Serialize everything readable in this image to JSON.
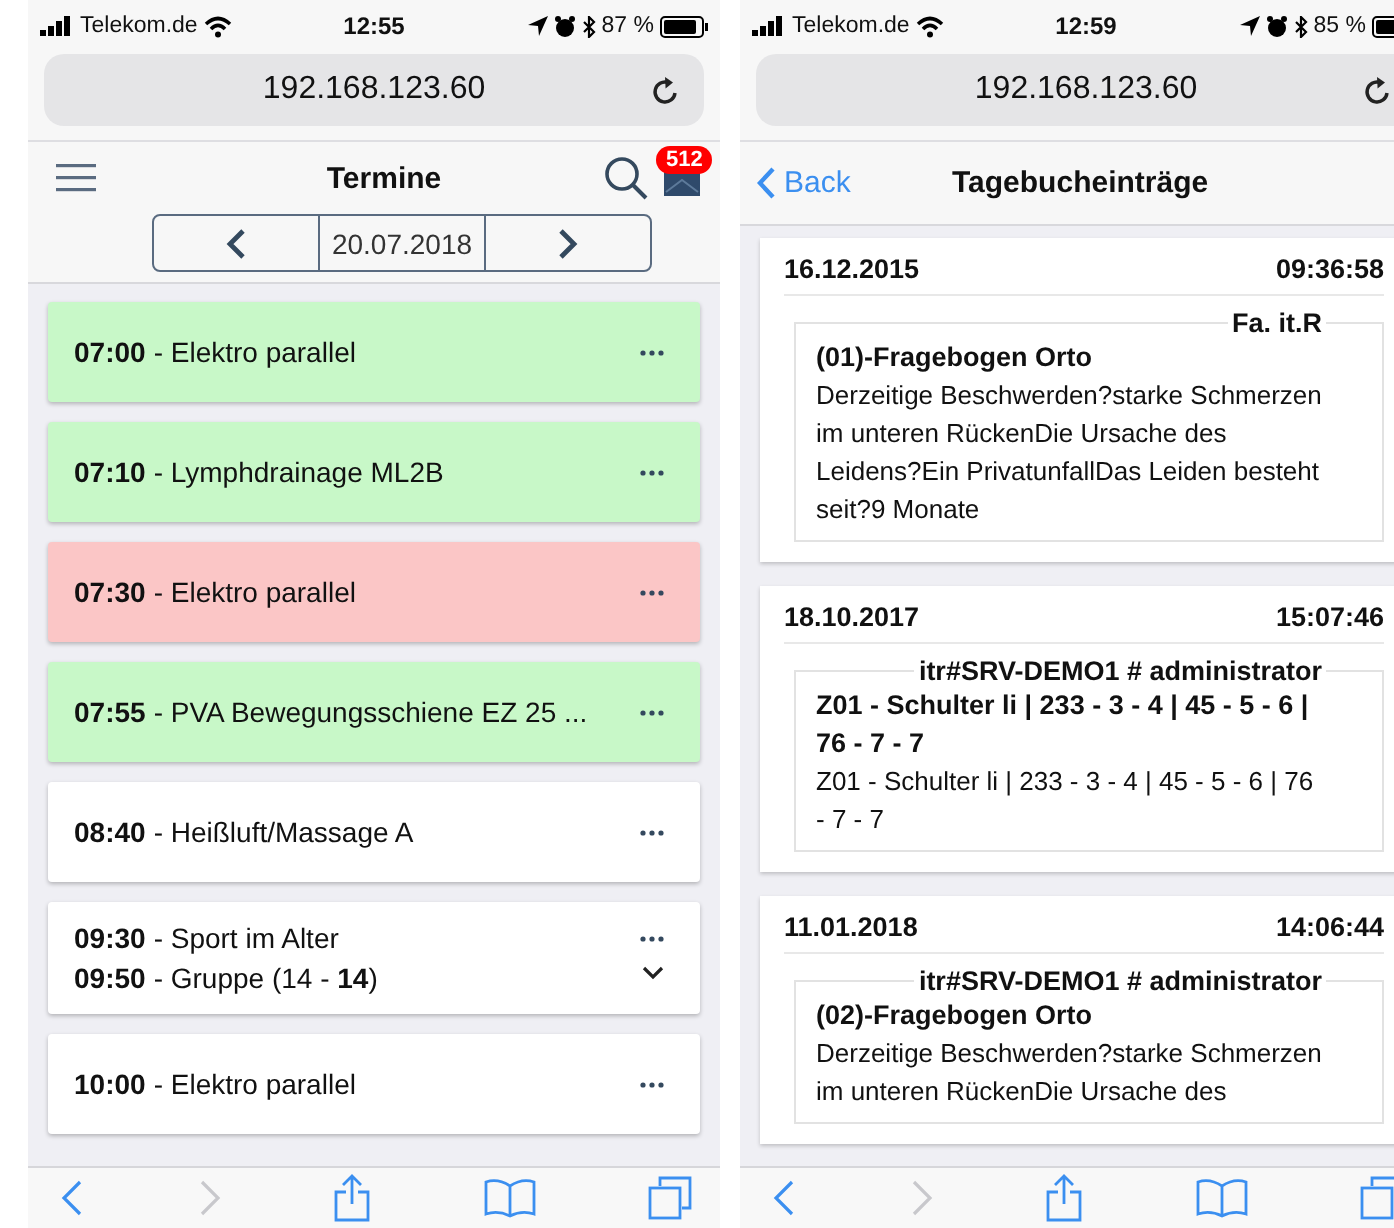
{
  "screens": [
    {
      "kind": "appointments",
      "status_bar": {
        "carrier": "Telekom.de",
        "time": "12:55",
        "battery": "87 %"
      },
      "address": "192.168.123.60",
      "title": "Termine",
      "badge": "512",
      "date": "20.07.2018",
      "appointments": [
        {
          "color": "#c8f8c8",
          "expandable": false,
          "lines": [
            {
              "time": "07:00",
              "title": "- Elektro parallel"
            }
          ]
        },
        {
          "color": "#c8f8c8",
          "expandable": false,
          "lines": [
            {
              "time": "07:10",
              "title": "- Lymphdrainage ML2B"
            }
          ]
        },
        {
          "color": "#fbc6c6",
          "expandable": false,
          "lines": [
            {
              "time": "07:30",
              "title": "- Elektro parallel"
            }
          ]
        },
        {
          "color": "#c8f8c8",
          "expandable": false,
          "lines": [
            {
              "time": "07:55",
              "title": "- PVA Bewegungsschiene EZ 25 ..."
            }
          ]
        },
        {
          "color": "#ffffff",
          "expandable": false,
          "lines": [
            {
              "time": "08:40",
              "title": "- Heißluft/Massage A"
            }
          ]
        },
        {
          "color": "#ffffff",
          "expandable": true,
          "lines": [
            {
              "time": "09:30",
              "title": "- Sport im Alter"
            },
            {
              "time": "09:50",
              "title": "- Gruppe (14 - **14**)"
            }
          ]
        },
        {
          "color": "#ffffff",
          "expandable": false,
          "lines": [
            {
              "time": "10:00",
              "title": "- Elektro parallel"
            }
          ]
        }
      ]
    },
    {
      "kind": "journal",
      "status_bar": {
        "carrier": "Telekom.de",
        "time": "12:59",
        "battery": "85 %"
      },
      "address": "192.168.123.60",
      "back": "Back",
      "title": "Tagebucheinträge",
      "entries": [
        {
          "date": "16.12.2015",
          "time": "09:36:58",
          "author": "Fa. it.R",
          "heading": "(01)-Fragebogen Orto",
          "text": "Derzeitige Beschwerden?starke Schmerzen im unteren RückenDie Ursache des Leidens?Ein PrivatunfallDas Leiden besteht seit?9 Monate"
        },
        {
          "date": "18.10.2017",
          "time": "15:07:46",
          "author": "itr#SRV-DEMO1 # administrator",
          "heading": "Z01 - Schulter li | 233 - 3 - 4 | 45 - 5 - 6 | 76 - 7 - 7",
          "text": "Z01 - Schulter li | 233 - 3 - 4 | 45 - 5 - 6 | 76 - 7 - 7"
        },
        {
          "date": "11.01.2018",
          "time": "14:06:44",
          "author": "itr#SRV-DEMO1 # administrator",
          "heading": "(02)-Fragebogen Orto",
          "text": "Derzeitige Beschwerden?starke Schmerzen im unteren RückenDie Ursache des"
        }
      ]
    }
  ]
}
